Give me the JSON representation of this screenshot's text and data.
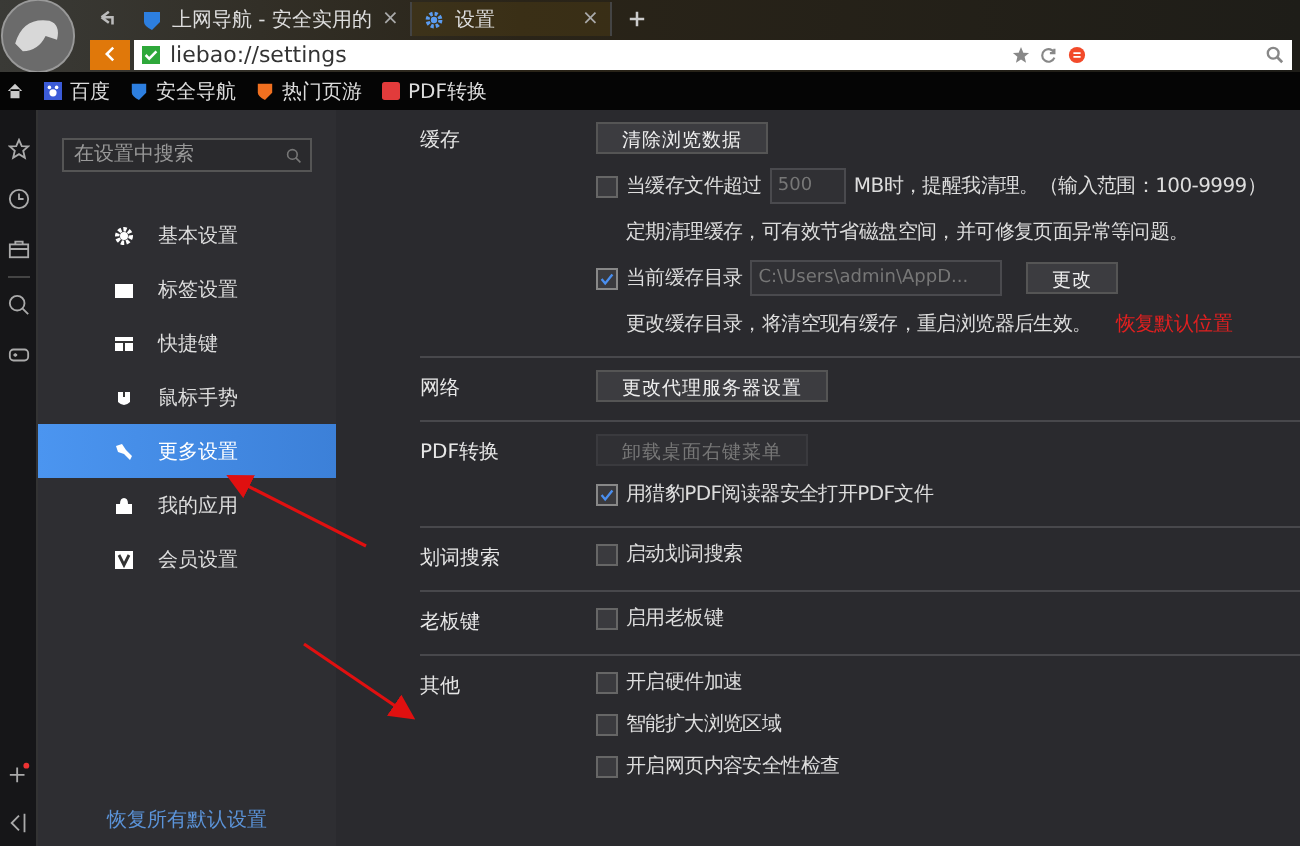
{
  "tabs": [
    {
      "title": "上网导航 - 安全实用的",
      "close": "×",
      "selected": false
    },
    {
      "title": "设置",
      "close": "×",
      "selected": true
    }
  ],
  "address": "liebao://settings",
  "bookmarks": [
    {
      "label": "百度"
    },
    {
      "label": "安全导航"
    },
    {
      "label": "热门页游"
    },
    {
      "label": "PDF转换"
    }
  ],
  "sidebar": {
    "search_placeholder": "在设置中搜索",
    "items": [
      {
        "label": "基本设置",
        "selected": false
      },
      {
        "label": "标签设置",
        "selected": false
      },
      {
        "label": "快捷键",
        "selected": false
      },
      {
        "label": "鼠标手势",
        "selected": false
      },
      {
        "label": "更多设置",
        "selected": true
      },
      {
        "label": "我的应用",
        "selected": false
      },
      {
        "label": "会员设置",
        "selected": false
      }
    ],
    "restore_link": "恢复所有默认设置"
  },
  "sections": [
    {
      "title": "缓存",
      "rows": [
        {
          "kind": "button",
          "label": "清除浏览数据",
          "disabled": false
        },
        {
          "kind": "checkbox",
          "label": "当缓存文件超过",
          "checked": false,
          "input": "500",
          "suffix": "MB时，提醒我清理。（输入范围：100-9999）"
        },
        {
          "kind": "note",
          "text": "定期清理缓存，可有效节省磁盘空间，并可修复页面异常等问题。"
        },
        {
          "kind": "checkbox",
          "label": "当前缓存目录",
          "checked": true,
          "input": "C:\\Users\\admin\\AppD...",
          "button": "更改"
        },
        {
          "kind": "note",
          "text": "更改缓存目录，将清空现有缓存，重启浏览器后生效。",
          "link": "恢复默认位置"
        }
      ]
    },
    {
      "title": "网络",
      "rows": [
        {
          "kind": "button",
          "label": "更改代理服务器设置",
          "disabled": false
        }
      ]
    },
    {
      "title": "PDF转换",
      "rows": [
        {
          "kind": "button",
          "label": "卸载桌面右键菜单",
          "disabled": true
        },
        {
          "kind": "checkbox",
          "label": "用猎豹PDF阅读器安全打开PDF文件",
          "checked": true
        }
      ]
    },
    {
      "title": "划词搜索",
      "rows": [
        {
          "kind": "checkbox",
          "label": "启动划词搜索",
          "checked": false
        }
      ]
    },
    {
      "title": "老板键",
      "rows": [
        {
          "kind": "checkbox",
          "label": "启用老板键",
          "checked": false
        }
      ]
    },
    {
      "title": "其他",
      "rows": [
        {
          "kind": "checkbox",
          "label": "开启硬件加速",
          "checked": false
        },
        {
          "kind": "checkbox",
          "label": "智能扩大浏览区域",
          "checked": false
        },
        {
          "kind": "checkbox",
          "label": "开启网页内容安全性检查",
          "checked": false
        }
      ]
    }
  ]
}
